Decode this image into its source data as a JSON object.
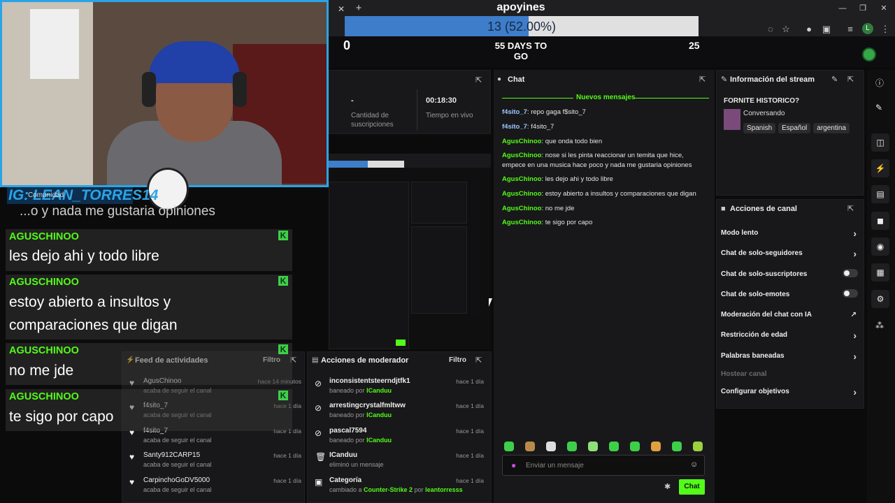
{
  "browser": {
    "window_title": "apoyines",
    "tab_close": "✕",
    "tab_new": "+",
    "win_min": "—",
    "win_max": "❐",
    "win_close": "✕"
  },
  "goal": {
    "progress_text": "13 (52.00%)",
    "progress_fraction": 0.52,
    "start": "0",
    "days_left": "55 DAYS TO GO",
    "target": "25"
  },
  "stats": {
    "subs_value": "-",
    "subs_label_1": "Cantidad de",
    "subs_label_2": "suscripciones",
    "live_value": "00:18:30",
    "live_label": "Tiempo en vivo"
  },
  "chat": {
    "title": "Chat",
    "new_messages": "Nuevos mensajes",
    "messages": [
      {
        "user": "f4sito_7",
        "color": "blue",
        "text": "repo gaga f$sito_7"
      },
      {
        "user": "f4sito_7",
        "color": "blue",
        "text": "f4sito_7"
      },
      {
        "user": "AgusChinoo",
        "color": "green",
        "text": "que onda todo bien"
      },
      {
        "user": "AgusChinoo",
        "color": "green",
        "text": "nose si les pinta reaccionar un temita que hice, empece en una musica hace poco y nada me gustaria opiniones"
      },
      {
        "user": "AgusChinoo",
        "color": "green",
        "text": "les dejo ahi y todo libre"
      },
      {
        "user": "AgusChinoo",
        "color": "green",
        "text": "estoy abierto a insultos y comparaciones que digan"
      },
      {
        "user": "AgusChinoo",
        "color": "green",
        "text": "no me jde"
      },
      {
        "user": "AgusChinoo",
        "color": "green",
        "text": "te sigo por capo"
      }
    ],
    "input_placeholder": "Enviar un mensaje",
    "send_label": "Chat"
  },
  "info": {
    "title": "Información del stream",
    "stream_title": "FORNITE HISTORICO?",
    "category": "Conversando",
    "tags": [
      "Spanish",
      "Español",
      "argentina"
    ]
  },
  "actions": {
    "title": "Acciones de canal",
    "items": [
      {
        "label": "Modo lento",
        "control": "chevron"
      },
      {
        "label": "Chat de solo-seguidores",
        "control": "chevron"
      },
      {
        "label": "Chat de solo-suscriptores",
        "control": "toggle"
      },
      {
        "label": "Chat de solo-emotes",
        "control": "toggle"
      },
      {
        "label": "Moderación del chat con IA",
        "control": "external"
      },
      {
        "label": "Restricción de edad",
        "control": "chevron"
      },
      {
        "label": "Palabras baneadas",
        "control": "chevron"
      },
      {
        "label": "Hostear canal",
        "control": "none"
      },
      {
        "label": "Configurar objetivos",
        "control": "chevron"
      }
    ]
  },
  "overlay": {
    "name_tag": "IG: LEAN_TORRES14",
    "community": "Comunidad",
    "partial_line": "...o y nada me gustaria opiniones",
    "messages": [
      {
        "user": "AGUSCHINOO",
        "text": "les dejo ahi y todo libre"
      },
      {
        "user": "AGUSCHINOO",
        "text": "estoy abierto a insultos y comparaciones que digan"
      },
      {
        "user": "AGUSCHINOO",
        "text": "no me jde"
      },
      {
        "user": "AGUSCHINOO",
        "text": "te sigo por capo"
      }
    ]
  },
  "feed": {
    "title": "Feed de actividades",
    "filter": "Filtro",
    "rows": [
      {
        "user": "AgusChinoo",
        "time": "hace 14 minutos",
        "desc": "acaba de seguir el canal"
      },
      {
        "user": "f4sito_7",
        "time": "hace 1 día",
        "desc": "acaba de seguir el canal"
      },
      {
        "user": "f4sito_7",
        "time": "hace 1 día",
        "desc": "acaba de seguir el canal"
      },
      {
        "user": "Santy912CARP15",
        "time": "hace 1 día",
        "desc": "acaba de seguir el canal"
      },
      {
        "user": "CarpinchoGoDV5000",
        "time": "hace 1 día",
        "desc": "acaba de seguir el canal"
      }
    ]
  },
  "mod": {
    "title": "Acciones de moderador",
    "filter": "Filtro",
    "rows": [
      {
        "user": "inconsistentsteerndjtfk1",
        "time": "hace 1 día",
        "pre": "baneado por",
        "link": "ICanduu",
        "post": "",
        "icon": "ban-icon"
      },
      {
        "user": "arrestingcrystalfmltww",
        "time": "hace 1 día",
        "pre": "baneado por",
        "link": "ICanduu",
        "post": "",
        "icon": "ban-icon"
      },
      {
        "user": "pascal7594",
        "time": "hace 1 día",
        "pre": "baneado por",
        "link": "ICanduu",
        "post": "",
        "icon": "ban-icon"
      },
      {
        "user": "ICanduu",
        "time": "hace 1 día",
        "pre": "eliminó un mensaje",
        "link": "",
        "post": "",
        "icon": "trash-icon"
      },
      {
        "user": "Categoría",
        "time": "hace 1 día",
        "pre": "cambiado a",
        "link": "Counter-Strike 2",
        "post": "por",
        "link2": "leantorresss",
        "icon": "category-icon"
      }
    ]
  }
}
